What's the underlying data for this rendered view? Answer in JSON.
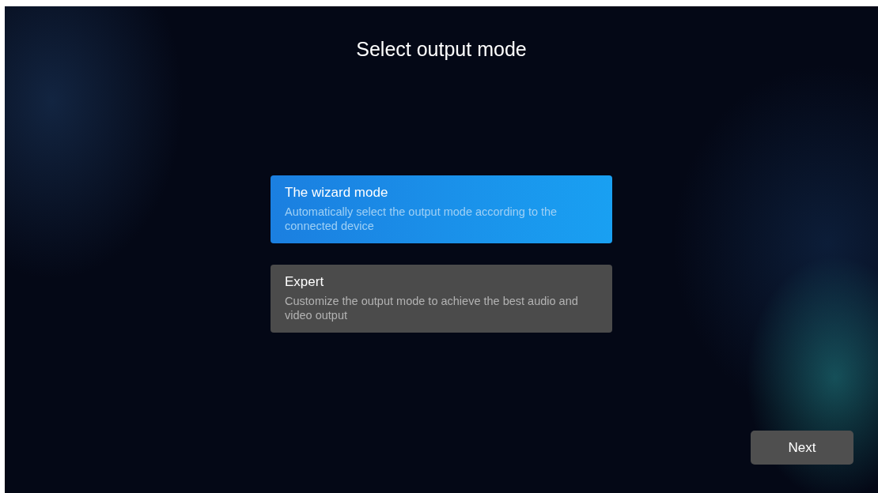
{
  "title": "Select output mode",
  "options": [
    {
      "label": "The wizard mode",
      "description": "Automatically select the output mode according to the connected device",
      "selected": true
    },
    {
      "label": "Expert",
      "description": "Customize the output mode to achieve the best audio and video output",
      "selected": false
    }
  ],
  "next_button": "Next"
}
